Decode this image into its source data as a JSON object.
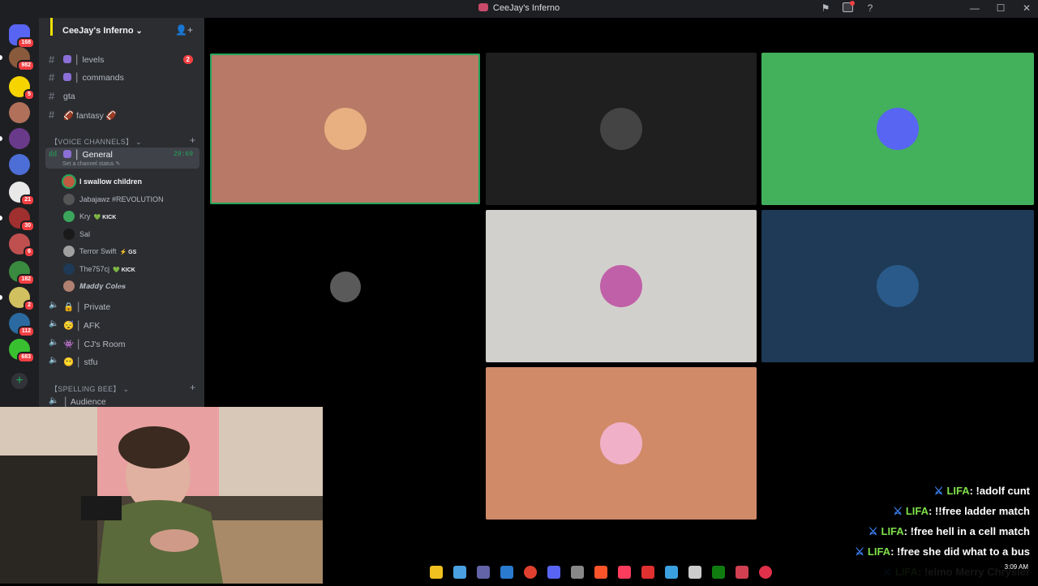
{
  "window": {
    "title": "CeeJay's Inferno",
    "controls": [
      "—",
      "☐",
      "✕"
    ]
  },
  "rail": {
    "servers": [
      {
        "name": "Direct Messages",
        "color": "#5865f2",
        "badge": "168"
      },
      {
        "name": "Server 1",
        "color": "#8a5a3c",
        "badge": "982"
      },
      {
        "name": "Server 2",
        "color": "#f5d400",
        "badge": "5"
      },
      {
        "name": "Server 3",
        "color": "#b0705a",
        "badge": ""
      },
      {
        "name": "Server 4",
        "color": "#6a3a8a",
        "badge": ""
      },
      {
        "name": "Server 5",
        "color": "#4c6ed6",
        "badge": ""
      },
      {
        "name": "Server 6",
        "color": "#e8e8e8",
        "badge": "21"
      },
      {
        "name": "Server 7",
        "color": "#a03030",
        "badge": "30"
      },
      {
        "name": "Server 8",
        "color": "#c05050",
        "badge": "6"
      },
      {
        "name": "Server 9",
        "color": "#3a8a40",
        "badge": "182"
      },
      {
        "name": "Server 10",
        "color": "#d0c060",
        "badge": "2"
      },
      {
        "name": "Server 11",
        "color": "#2a6aa0",
        "badge": "112"
      },
      {
        "name": "Server 12",
        "color": "#38c030",
        "badge": "683"
      }
    ]
  },
  "guild": {
    "name": "CeeJay's Inferno"
  },
  "channels": [
    {
      "label": "│ levels",
      "icon_color": "#8c6fd6",
      "count": "2"
    },
    {
      "label": "│ commands",
      "icon_color": "#9a6fd6",
      "count": ""
    },
    {
      "label": "gta",
      "icon_color": "",
      "count": ""
    },
    {
      "label": "🏈 fantasy 🏈",
      "icon_color": "",
      "count": ""
    }
  ],
  "voice_category": "【VOICE CHANNELS】",
  "active_voice": {
    "label": "│ General",
    "status": "Set a channel status ✎",
    "timer": "29:69"
  },
  "voice_users": [
    {
      "name": "I swallow children",
      "tag": "",
      "avatar": "#c05a40",
      "speaking": true
    },
    {
      "name": "Jabajawz #REVOLUTION",
      "tag": "",
      "avatar": "#555555",
      "speaking": false
    },
    {
      "name": "Kry",
      "tag": "💚 KICK",
      "avatar": "#3ba55c",
      "speaking": false
    },
    {
      "name": "Sal",
      "tag": "",
      "avatar": "#1a1a1a",
      "speaking": false
    },
    {
      "name": "Terror Swift",
      "tag": "⚡ GS",
      "avatar": "#a0a0a0",
      "speaking": false
    },
    {
      "name": "The757cj",
      "tag": "💚 KICK",
      "avatar": "#1e3a56",
      "speaking": false
    },
    {
      "name": "𝑴𝒂𝒅𝒅𝒚 𝑪𝒐𝒍𝒆𝒔",
      "tag": "",
      "avatar": "#b08070",
      "speaking": false
    }
  ],
  "voice_channels": [
    {
      "label": "│ Private",
      "icon": "🔒"
    },
    {
      "label": "│ AFK",
      "icon": "😴"
    },
    {
      "label": "│ CJ's Room",
      "icon": "👾"
    },
    {
      "label": "│ stfu",
      "icon": "😶"
    }
  ],
  "spelling_category": "【SPELLING BEE】",
  "audience_channel": "│ Audience",
  "tiles": [
    {
      "bg": "#b87a66",
      "avatar": "#e8b080",
      "speaking": true
    },
    {
      "bg": "#1f1f1f",
      "avatar": "#444444",
      "speaking": false
    },
    {
      "bg": "#43b05c",
      "avatar": "#5865f2",
      "speaking": false
    },
    {
      "bg": "#000000",
      "avatar": "#5a5a5a",
      "speaking": false
    },
    {
      "bg": "#d2d0cc",
      "avatar": "#c060a8",
      "speaking": false
    },
    {
      "bg": "#1e3a56",
      "avatar": "#2a5a8a",
      "speaking": false
    },
    {
      "bg": "#d08a68",
      "avatar": "#f0b0c8",
      "speaking": false
    }
  ],
  "chat": [
    {
      "name": "LIFA",
      "msg": ": !adolf cunt"
    },
    {
      "name": "LIFA",
      "msg": ": !!free ladder match"
    },
    {
      "name": "LIFA",
      "msg": ": !free hell in a cell match"
    },
    {
      "name": "LIFA",
      "msg": ": !free she did what to a bus"
    },
    {
      "name": "LIFA",
      "msg": ": !elmo Merry Chrysler"
    }
  ],
  "clock": "3:09 AM",
  "taskbar_apps": [
    {
      "name": "file-explorer",
      "color": "#f0c020"
    },
    {
      "name": "copilot",
      "color": "#4aa0e0"
    },
    {
      "name": "teams",
      "color": "#6264a7"
    },
    {
      "name": "store",
      "color": "#2a7ad0"
    },
    {
      "name": "chrome",
      "color": "#e04030"
    },
    {
      "name": "discord",
      "color": "#5865f2"
    },
    {
      "name": "app-7",
      "color": "#888888"
    },
    {
      "name": "brave",
      "color": "#fb542b"
    },
    {
      "name": "itunes",
      "color": "#fc3c5c"
    },
    {
      "name": "app-10",
      "color": "#e03030"
    },
    {
      "name": "app-11",
      "color": "#3aa0e0"
    },
    {
      "name": "app-12",
      "color": "#cccccc"
    },
    {
      "name": "xbox",
      "color": "#107c10"
    },
    {
      "name": "app-14",
      "color": "#d04050"
    },
    {
      "name": "obs",
      "color": "#e0304a"
    }
  ]
}
